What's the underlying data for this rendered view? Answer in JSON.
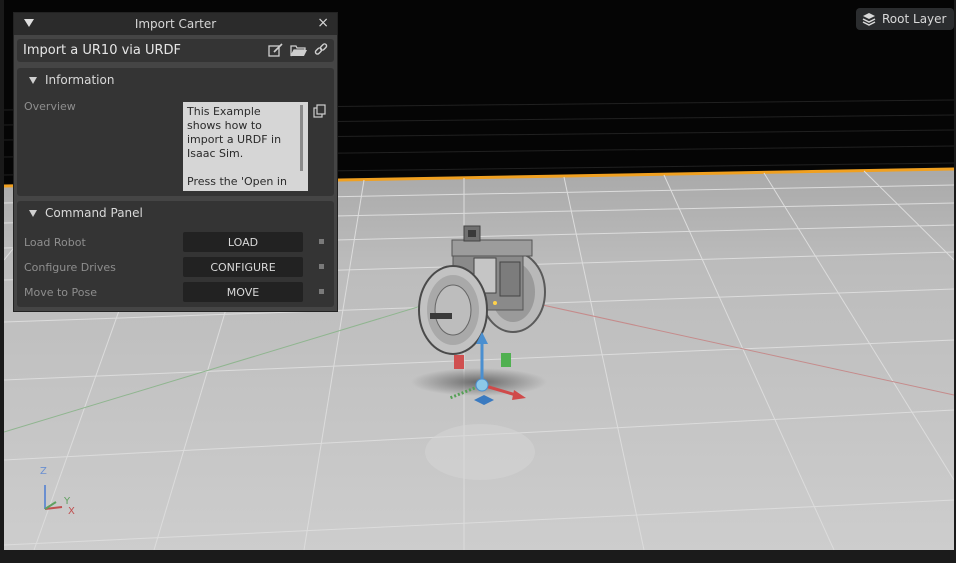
{
  "window": {
    "title": "Import Carter",
    "close_symbol": "×"
  },
  "header": {
    "title": "Import a UR10 via URDF",
    "icons": [
      "edit-icon",
      "folder-open-icon",
      "link-icon"
    ]
  },
  "information": {
    "title": "Information",
    "overview_label": "Overview",
    "overview_text": "This Example\nshows how to\nimport a URDF in\nIsaac Sim.\n\nPress the 'Open in"
  },
  "command_panel": {
    "title": "Command Panel",
    "rows": [
      {
        "label": "Load Robot",
        "button": "LOAD"
      },
      {
        "label": "Configure Drives",
        "button": "CONFIGURE"
      },
      {
        "label": "Move to Pose",
        "button": "MOVE"
      }
    ]
  },
  "root_layer": {
    "label": "Root Layer"
  },
  "axes": {
    "z": "Z",
    "y": "Y",
    "x": "X"
  },
  "colors": {
    "panel_bg": "#454545",
    "section_bg": "#343434",
    "button_bg": "#222222",
    "floor": "#c4c4c4",
    "sky": "#050505",
    "grid_edge": "#f0a020"
  }
}
